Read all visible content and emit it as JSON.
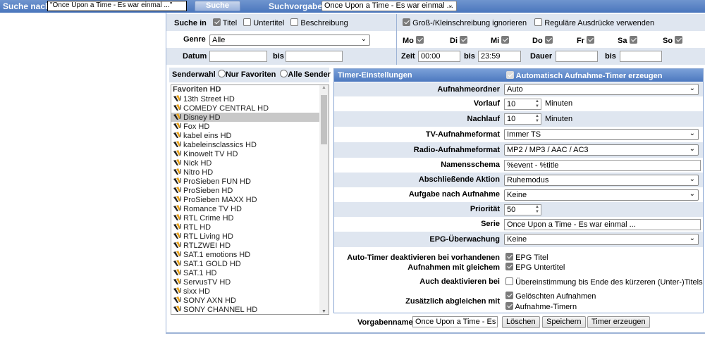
{
  "topbar": {
    "search_label": "Suche nach",
    "search_value": "\"Once Upon a Time - Es war einmal ...\"",
    "search_button": "Suche",
    "preset_label": "Suchvorgabe",
    "preset_value": "Once Upon a Time - Es war einmal ..."
  },
  "filters": {
    "search_in_label": "Suche in",
    "title": "Titel",
    "subtitle": "Untertitel",
    "description": "Beschreibung",
    "ignore_case": "Groß-/Kleinschreibung ignorieren",
    "regex": "Reguläre Ausdrücke verwenden",
    "genre_label": "Genre",
    "genre_value": "Alle",
    "date_label": "Datum",
    "bis": "bis",
    "date_from": "",
    "date_to": "",
    "time_label": "Zeit",
    "time_from": "00:00",
    "time_to": "23:59",
    "duration_label": "Dauer",
    "duration_from": "",
    "duration_to": "",
    "days": [
      {
        "label": "Mo",
        "checked": true
      },
      {
        "label": "Di",
        "checked": true
      },
      {
        "label": "Mi",
        "checked": true
      },
      {
        "label": "Do",
        "checked": true
      },
      {
        "label": "Fr",
        "checked": true
      },
      {
        "label": "Sa",
        "checked": true
      },
      {
        "label": "So",
        "checked": true
      }
    ]
  },
  "channels": {
    "label": "Senderwahl",
    "only_fav": "Nur Favoriten",
    "all": "Alle Sender",
    "group": "Favoriten HD",
    "selected": "Disney HD",
    "items": [
      "13th Street HD",
      "COMEDY CENTRAL HD",
      "Disney HD",
      "Fox HD",
      "kabel eins HD",
      "kabeleinsclassics HD",
      "Kinowelt TV HD",
      "Nick HD",
      "Nitro HD",
      "ProSieben FUN HD",
      "ProSieben HD",
      "ProSieben MAXX HD",
      "Romance TV HD",
      "RTL Crime HD",
      "RTL HD",
      "RTL Living HD",
      "RTLZWEI HD",
      "SAT.1 emotions HD",
      "SAT.1 GOLD HD",
      "SAT.1 HD",
      "ServusTV HD",
      "sixx HD",
      "SONY AXN HD",
      "SONY CHANNEL HD"
    ]
  },
  "timer": {
    "title": "Timer-Einstellungen",
    "auto_create": "Automatisch Aufnahme-Timer erzeugen",
    "folder_label": "Aufnahmeordner",
    "folder": "Auto",
    "pre_label": "Vorlauf",
    "pre": "10",
    "minutes": "Minuten",
    "post_label": "Nachlauf",
    "post": "10",
    "tv_label": "TV-Aufnahmeformat",
    "tv": "Immer TS",
    "radio_label": "Radio-Aufnahmeformat",
    "radio": "MP2 / MP3 / AAC / AC3",
    "name_label": "Namensschema",
    "name": "%event - %title",
    "action_label": "Abschließende Aktion",
    "action": "Ruhemodus",
    "task_label": "Aufgabe nach Aufnahme",
    "task": "Keine",
    "prio_label": "Priorität",
    "prio": "50",
    "series_label": "Serie",
    "series": "Once Upon a Time - Es war einmal ...",
    "epg_label": "EPG-Überwachung",
    "epg": "Keine",
    "deact_label1": "Auto-Timer deaktivieren bei vorhandenen",
    "deact_label2": "Aufnahmen mit gleichem",
    "epg_title": "EPG Titel",
    "epg_subtitle": "EPG Untertitel",
    "also_label": "Auch deaktivieren bei",
    "also": "Übereinstimmung bis Ende des kürzeren (Unter-)Titels",
    "extra_label": "Zusätzlich abgleichen mit",
    "deleted": "Gelöschten Aufnahmen",
    "timers": "Aufnahme-Timern"
  },
  "footer": {
    "name_label": "Vorgabenname",
    "name": "Once Upon a Time - Es war einmal ...",
    "delete": "Löschen",
    "save": "Speichern",
    "create": "Timer erzeugen"
  }
}
